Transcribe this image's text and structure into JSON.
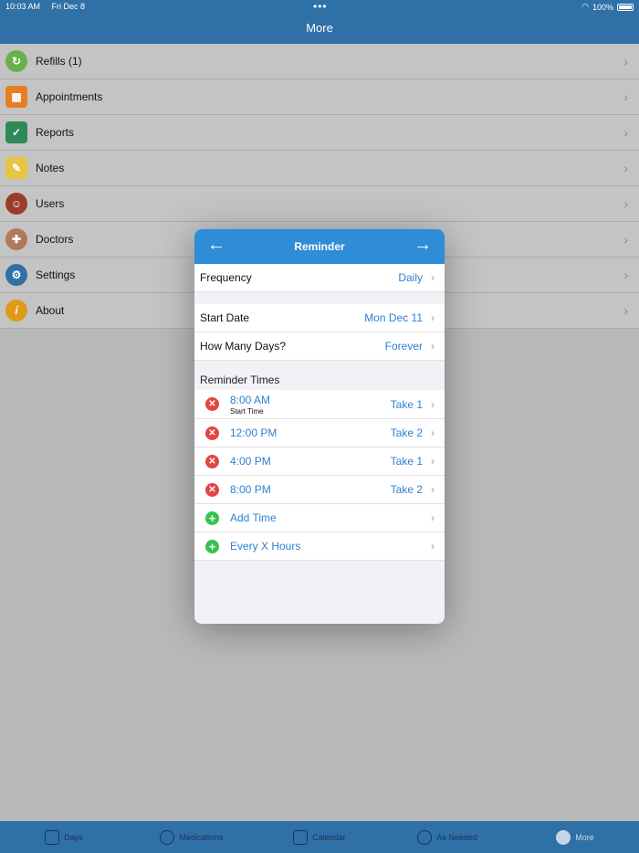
{
  "status": {
    "time": "10:03 AM",
    "date": "Fri Dec 8",
    "battery": "100%"
  },
  "nav": {
    "title": "More"
  },
  "menu": [
    {
      "label": "Refills (1)",
      "icon": "refills-icon",
      "color": "#6ab04c"
    },
    {
      "label": "Appointments",
      "icon": "appointments-icon",
      "color": "#e67e22"
    },
    {
      "label": "Reports",
      "icon": "reports-icon",
      "color": "#2e8b57"
    },
    {
      "label": "Notes",
      "icon": "notes-icon",
      "color": "#e5c542"
    },
    {
      "label": "Users",
      "icon": "users-icon",
      "color": "#9b3b2b"
    },
    {
      "label": "Doctors",
      "icon": "doctors-icon",
      "color": "#b07a5a"
    },
    {
      "label": "Settings",
      "icon": "settings-icon",
      "color": "#2f70a6"
    },
    {
      "label": "About",
      "icon": "about-icon",
      "color": "#e09a1a"
    }
  ],
  "modal": {
    "title": "Reminder",
    "frequency": {
      "label": "Frequency",
      "value": "Daily"
    },
    "start_date": {
      "label": "Start Date",
      "value": "Mon Dec 11"
    },
    "how_many_days": {
      "label": "How Many Days?",
      "value": "Forever"
    },
    "reminder_times_header": "Reminder Times",
    "times": [
      {
        "time": "8:00 AM",
        "sub": "Start Time",
        "dose": "Take 1"
      },
      {
        "time": "12:00 PM",
        "dose": "Take 2"
      },
      {
        "time": "4:00 PM",
        "dose": "Take 1"
      },
      {
        "time": "8:00 PM",
        "dose": "Take 2"
      }
    ],
    "add_time": "Add Time",
    "every_x_hours": "Every X Hours"
  },
  "tabs": [
    {
      "label": "Days",
      "icon": "house-icon"
    },
    {
      "label": "Medications",
      "icon": "pills-icon"
    },
    {
      "label": "Calendar",
      "icon": "calendar-icon"
    },
    {
      "label": "As Needed",
      "icon": "plus-circle-icon"
    },
    {
      "label": "More",
      "icon": "more-icon",
      "active": true
    }
  ],
  "colors": {
    "nav": "#2f70a6",
    "accent": "#2f8cd7",
    "link": "#2f80cf",
    "remove": "#e34545",
    "add": "#36c34c"
  }
}
